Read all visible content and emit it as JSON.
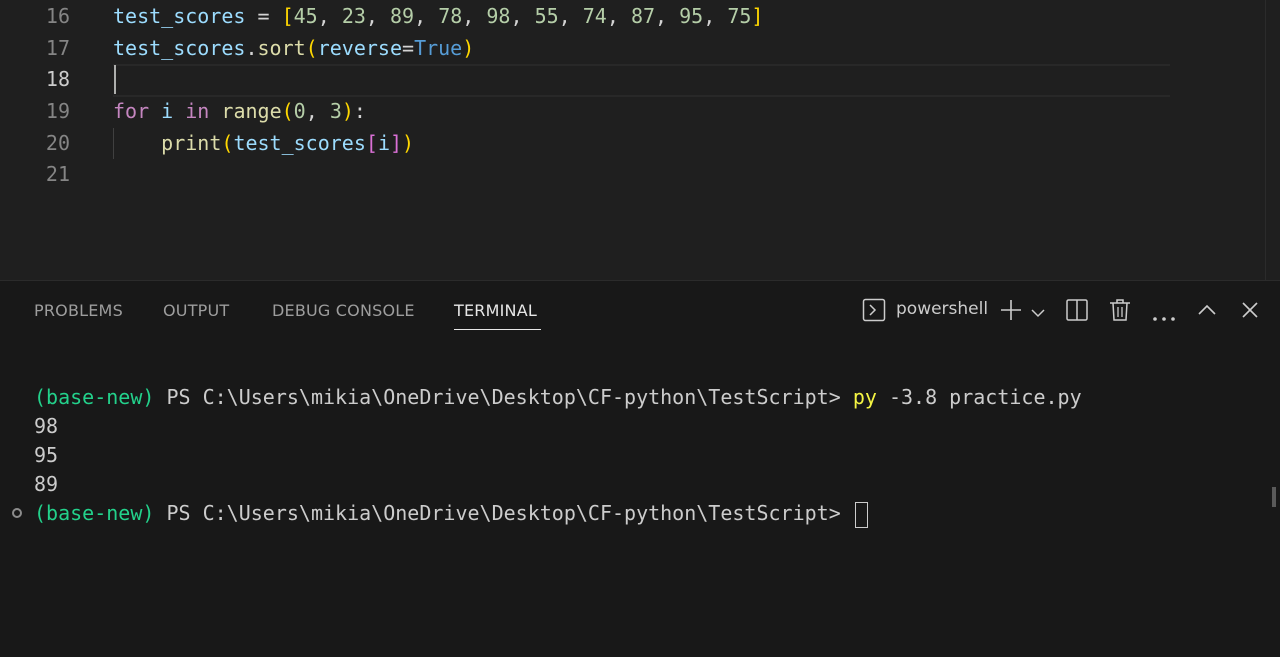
{
  "editor": {
    "lines": [
      {
        "num": "16",
        "tokens": [
          {
            "t": "test_scores",
            "c": "var"
          },
          {
            "t": " = ",
            "c": "op"
          },
          {
            "t": "[",
            "c": "b1"
          },
          {
            "t": "45",
            "c": "num"
          },
          {
            "t": ", ",
            "c": "op"
          },
          {
            "t": "23",
            "c": "num"
          },
          {
            "t": ", ",
            "c": "op"
          },
          {
            "t": "89",
            "c": "num"
          },
          {
            "t": ", ",
            "c": "op"
          },
          {
            "t": "78",
            "c": "num"
          },
          {
            "t": ", ",
            "c": "op"
          },
          {
            "t": "98",
            "c": "num"
          },
          {
            "t": ", ",
            "c": "op"
          },
          {
            "t": "55",
            "c": "num"
          },
          {
            "t": ", ",
            "c": "op"
          },
          {
            "t": "74",
            "c": "num"
          },
          {
            "t": ", ",
            "c": "op"
          },
          {
            "t": "87",
            "c": "num"
          },
          {
            "t": ", ",
            "c": "op"
          },
          {
            "t": "95",
            "c": "num"
          },
          {
            "t": ", ",
            "c": "op"
          },
          {
            "t": "75",
            "c": "num"
          },
          {
            "t": "]",
            "c": "b1"
          }
        ]
      },
      {
        "num": "17",
        "tokens": [
          {
            "t": "test_scores",
            "c": "var"
          },
          {
            "t": ".",
            "c": "op"
          },
          {
            "t": "sort",
            "c": "fn"
          },
          {
            "t": "(",
            "c": "b1"
          },
          {
            "t": "reverse",
            "c": "var"
          },
          {
            "t": "=",
            "c": "op"
          },
          {
            "t": "True",
            "c": "const"
          },
          {
            "t": ")",
            "c": "b1"
          }
        ]
      },
      {
        "num": "18",
        "active": true,
        "tokens": []
      },
      {
        "num": "19",
        "tokens": [
          {
            "t": "for",
            "c": "kw"
          },
          {
            "t": " ",
            "c": "op"
          },
          {
            "t": "i",
            "c": "var"
          },
          {
            "t": " ",
            "c": "op"
          },
          {
            "t": "in",
            "c": "kw"
          },
          {
            "t": " ",
            "c": "op"
          },
          {
            "t": "range",
            "c": "fn"
          },
          {
            "t": "(",
            "c": "b1"
          },
          {
            "t": "0",
            "c": "num"
          },
          {
            "t": ", ",
            "c": "op"
          },
          {
            "t": "3",
            "c": "num"
          },
          {
            "t": ")",
            "c": "b1"
          },
          {
            "t": ":",
            "c": "op"
          }
        ]
      },
      {
        "num": "20",
        "tokens": [
          {
            "t": "    ",
            "c": "op"
          },
          {
            "t": "print",
            "c": "fn"
          },
          {
            "t": "(",
            "c": "b1"
          },
          {
            "t": "test_scores",
            "c": "var"
          },
          {
            "t": "[",
            "c": "b2"
          },
          {
            "t": "i",
            "c": "var"
          },
          {
            "t": "]",
            "c": "b2"
          },
          {
            "t": ")",
            "c": "b1"
          }
        ]
      },
      {
        "num": "21",
        "tokens": []
      }
    ]
  },
  "panel": {
    "tabs": [
      {
        "label": "PROBLEMS",
        "active": false
      },
      {
        "label": "OUTPUT",
        "active": false
      },
      {
        "label": "DEBUG CONSOLE",
        "active": false
      },
      {
        "label": "TERMINAL",
        "active": true
      }
    ],
    "shell_name": "powershell",
    "icons": {
      "shell": "terminal-prompt-icon",
      "new_terminal": "plus-icon",
      "dropdown": "chevron-down-icon",
      "split": "split-panel-icon",
      "kill": "trash-icon",
      "more": "ellipsis-icon",
      "maximize": "chevron-up-icon",
      "close": "close-icon"
    }
  },
  "terminal": {
    "env": "(base-new)",
    "prompt": " PS C:\\Users\\mikia\\OneDrive\\Desktop\\CF-python\\TestScript> ",
    "command_name": "py",
    "command_args": " -3.8 practice.py",
    "output": [
      "98",
      "95",
      "89"
    ]
  },
  "colors": {
    "editor_bg": "#1f1f1f",
    "panel_bg": "#181818",
    "env_green": "#23d18b",
    "command_yellow": "#f5f543"
  }
}
